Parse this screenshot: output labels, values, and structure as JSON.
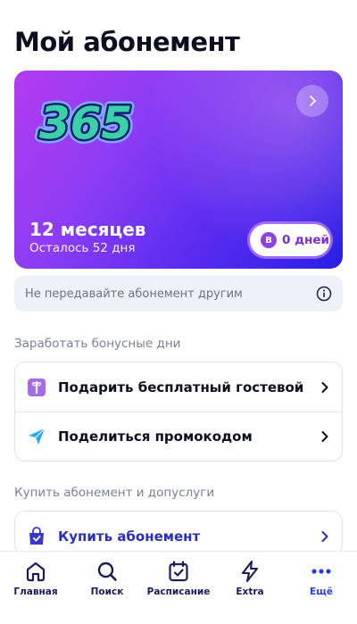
{
  "page": {
    "title": "Мой абонемент"
  },
  "subscription": {
    "logo_text": "365",
    "period": "12 месяцев",
    "remaining": "Осталось 52 дня",
    "bonus_badge": "B",
    "bonus_days": "0 дней"
  },
  "notice": {
    "text": "Не передавайте абонемент другим"
  },
  "bonus_section": {
    "label": "Заработать бонусные дни",
    "items": [
      {
        "label": "Подарить бесплатный гостевой",
        "icon": "gift-icon"
      },
      {
        "label": "Поделиться промокодом",
        "icon": "share-icon"
      }
    ]
  },
  "buy_section": {
    "label": "Купить абонемент и допуслуги",
    "items": [
      {
        "label": "Купить абонемент",
        "icon": "shopping-bag-icon"
      }
    ]
  },
  "tabbar": {
    "tabs": [
      {
        "label": "Главная",
        "icon": "home-icon"
      },
      {
        "label": "Поиск",
        "icon": "search-icon"
      },
      {
        "label": "Расписание",
        "icon": "calendar-icon"
      },
      {
        "label": "Extra",
        "icon": "lightning-icon"
      },
      {
        "label": "Ещё",
        "icon": "more-icon"
      }
    ],
    "active_index": 4
  },
  "colors": {
    "accent": "#2a3fd8",
    "card_gradient_start": "#b43bf0",
    "card_gradient_end": "#2a1fe6",
    "bonus_purple": "#7a2fd0"
  }
}
